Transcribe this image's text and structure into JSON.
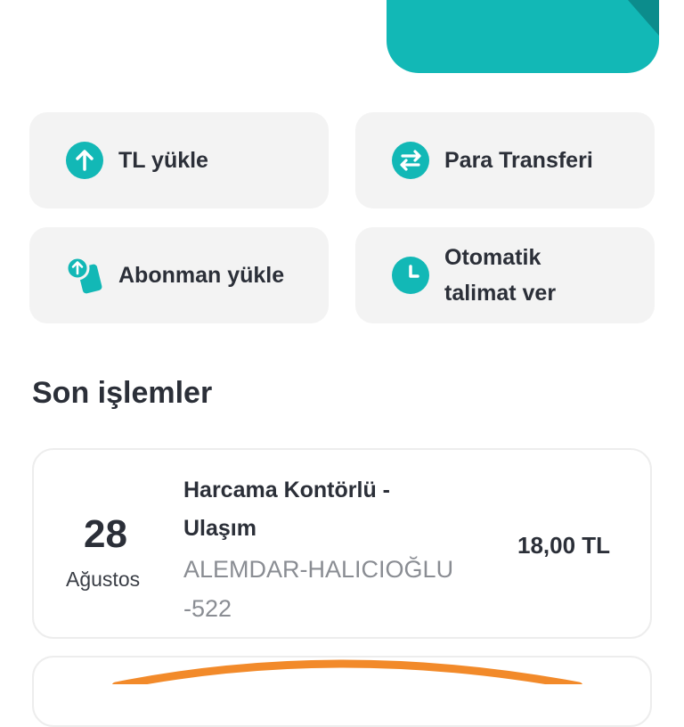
{
  "colors": {
    "accent": "#12b8b6",
    "accent_dark": "#0c8c8c",
    "tile_bg": "#f3f3f3",
    "text_primary": "#2b2f38",
    "text_secondary": "#8a8d93",
    "highlight": "#f28a2a"
  },
  "quick_actions": [
    {
      "label": "TL yükle",
      "icon": "arrow-up-circle-icon"
    },
    {
      "label": "Para Transferi",
      "icon": "transfer-arrows-icon"
    },
    {
      "label": "Abonman yükle",
      "icon": "card-topup-icon"
    },
    {
      "label": "Otomatik talimat ver",
      "icon": "clock-icon"
    }
  ],
  "recent": {
    "title": "Son işlemler",
    "items": [
      {
        "day": "28",
        "month": "Ağustos",
        "title": "Harcama Kontörlü - Ulaşım",
        "subtitle": "ALEMDAR-HALICIOĞLU -522",
        "amount": "18,00 TL"
      }
    ]
  }
}
